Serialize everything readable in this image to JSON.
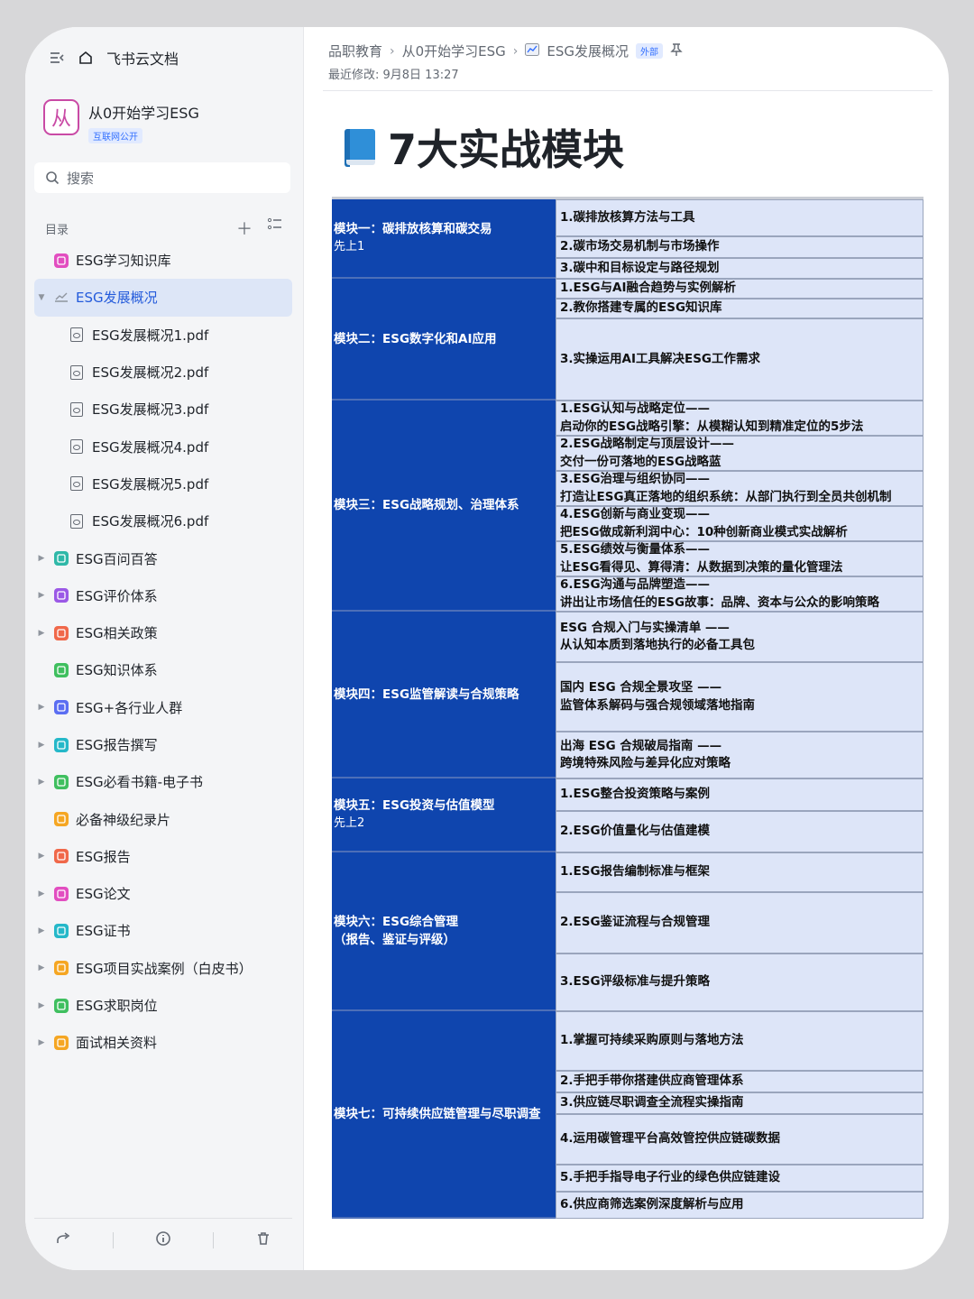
{
  "sidebar": {
    "app_name": "飞书云文档",
    "space": {
      "logo_char": "从",
      "name": "从0开始学习ESG",
      "tag": "互联网公开"
    },
    "search_placeholder": "搜索",
    "toc_label": "目录",
    "items": [
      {
        "label": "ESG学习知识库",
        "kind": "doc",
        "color": "#e24ec0",
        "caret": ""
      },
      {
        "label": "ESG发展概况",
        "kind": "chart",
        "color": "#8f959e",
        "caret": "▼",
        "active": true
      },
      {
        "label": "ESG发展概况1.pdf",
        "kind": "pdf"
      },
      {
        "label": "ESG发展概况2.pdf",
        "kind": "pdf"
      },
      {
        "label": "ESG发展概况3.pdf",
        "kind": "pdf"
      },
      {
        "label": "ESG发展概况4.pdf",
        "kind": "pdf"
      },
      {
        "label": "ESG发展概况5.pdf",
        "kind": "pdf"
      },
      {
        "label": "ESG发展概况6.pdf",
        "kind": "pdf"
      },
      {
        "label": "ESG百问百答",
        "kind": "doc",
        "color": "#2fb8a8",
        "caret": "▶"
      },
      {
        "label": "ESG评价体系",
        "kind": "doc",
        "color": "#9b59e6",
        "caret": "▶"
      },
      {
        "label": "ESG相关政策",
        "kind": "doc",
        "color": "#f0684a",
        "caret": "▶"
      },
      {
        "label": "ESG知识体系",
        "kind": "doc",
        "color": "#3fbf5f",
        "caret": ""
      },
      {
        "label": "ESG+各行业人群",
        "kind": "doc",
        "color": "#5b6ef2",
        "caret": "▶"
      },
      {
        "label": "ESG报告撰写",
        "kind": "doc",
        "color": "#25b8c9",
        "caret": "▶"
      },
      {
        "label": "ESG必看书籍-电子书",
        "kind": "doc",
        "color": "#3fbf5f",
        "caret": "▶"
      },
      {
        "label": "必备神级纪录片",
        "kind": "doc",
        "color": "#f5a623",
        "caret": ""
      },
      {
        "label": "ESG报告",
        "kind": "doc",
        "color": "#f0684a",
        "caret": "▶"
      },
      {
        "label": "ESG论文",
        "kind": "doc",
        "color": "#e24ec0",
        "caret": "▶"
      },
      {
        "label": "ESG证书",
        "kind": "doc",
        "color": "#25b8c9",
        "caret": "▶"
      },
      {
        "label": "ESG项目实战案例（白皮书）",
        "kind": "doc",
        "color": "#f5a623",
        "caret": "▶"
      },
      {
        "label": "ESG求职岗位",
        "kind": "doc",
        "color": "#3fbf5f",
        "caret": "▶"
      },
      {
        "label": "面试相关资料",
        "kind": "doc",
        "color": "#f5a623",
        "caret": "▶"
      }
    ]
  },
  "header": {
    "breadcrumb": [
      "品职教育",
      "从0开始学习ESG",
      "ESG发展概况"
    ],
    "external_tag": "外部",
    "last_modified": "最近修改: 9月8日 13:27"
  },
  "page": {
    "title": "7大实战模块"
  },
  "modules": [
    {
      "name": "模块一：碳排放核算和碳交易",
      "sub": "先上1",
      "rows": [
        "1.碳排放核算方法与工具",
        "2.碳市场交易机制与市场操作",
        "3.碳中和目标设定与路径规划"
      ]
    },
    {
      "name": "模块二：ESG数字化和AI应用",
      "sub": "",
      "rows": [
        "1.ESG与AI融合趋势与实例解析",
        "2.教你搭建专属的ESG知识库",
        "3.实操运用AI工具解决ESG工作需求"
      ]
    },
    {
      "name": "模块三：ESG战略规划、治理体系",
      "sub": "",
      "rows": [
        [
          "1.ESG认知与战略定位——",
          "启动你的ESG战略引擎：从模糊认知到精准定位的5步法"
        ],
        [
          "2.ESG战略制定与顶层设计——",
          "交付一份可落地的ESG战略蓝"
        ],
        [
          "3.ESG治理与组织协同——",
          "打造让ESG真正落地的组织系统：从部门执行到全员共创机制"
        ],
        [
          "4.ESG创新与商业变现——",
          "把ESG做成新利润中心：10种创新商业模式实战解析"
        ],
        [
          "5.ESG绩效与衡量体系——",
          "让ESG看得见、算得清：从数据到决策的量化管理法"
        ],
        [
          "6.ESG沟通与品牌塑造——",
          "讲出让市场信任的ESG故事：品牌、资本与公众的影响策略"
        ]
      ]
    },
    {
      "name": "模块四：ESG监管解读与合规策略",
      "sub": "",
      "rows": [
        [
          "ESG 合规入门与实操清单 ——",
          "从认知本质到落地执行的必备工具包"
        ],
        [
          "国内 ESG 合规全景攻坚 ——",
          "监管体系解码与强合规领域落地指南"
        ],
        [
          "出海 ESG 合规破局指南 ——",
          "跨境特殊风险与差异化应对策略"
        ]
      ]
    },
    {
      "name": "模块五：ESG投资与估值模型",
      "sub": "先上2",
      "rows": [
        "1.ESG整合投资策略与案例",
        "2.ESG价值量化与估值建模"
      ]
    },
    {
      "name": "模块六：ESG综合管理",
      "sub2": "（报告、鉴证与评级）",
      "sub": "",
      "rows": [
        "1.ESG报告编制标准与框架",
        "2.ESG鉴证流程与合规管理",
        "3.ESG评级标准与提升策略"
      ]
    },
    {
      "name": "模块七：可持续供应链管理与尽职调查",
      "sub": "",
      "rows": [
        "1.掌握可持续采购原则与落地方法",
        "2.手把手带你搭建供应商管理体系",
        "3.供应链尽职调查全流程实操指南",
        "4.运用碳管理平台高效管控供应链碳数据",
        "5.手把手指导电子行业的绿色供应链建设",
        "6.供应商筛选案例深度解析与应用"
      ]
    }
  ]
}
